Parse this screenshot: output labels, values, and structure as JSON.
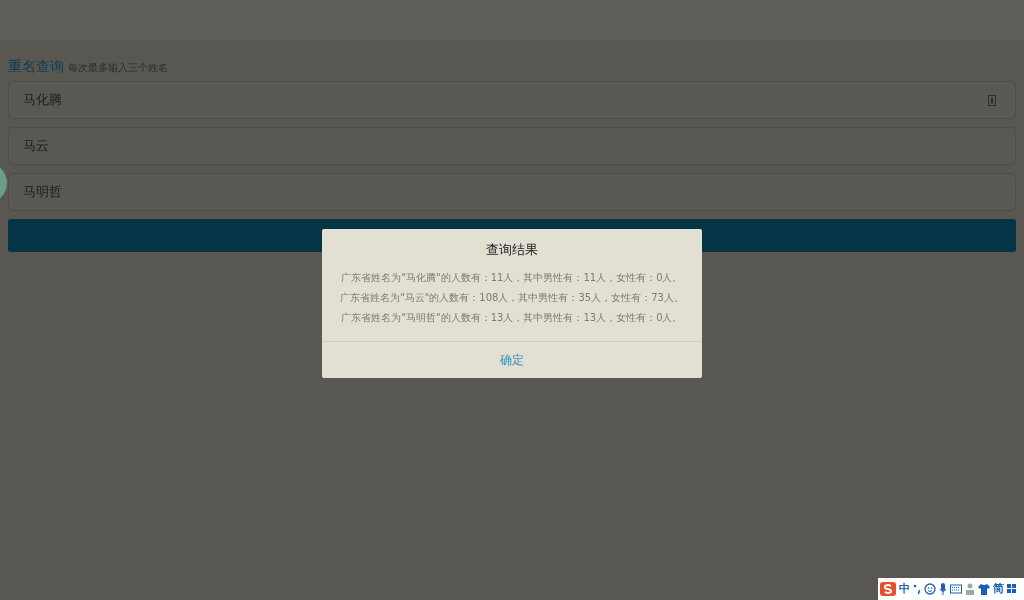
{
  "page": {
    "title": "重名查询",
    "hint": "每次最多输入三个姓名"
  },
  "fields": [
    {
      "value": "马化腾",
      "has_icon": true
    },
    {
      "value": "马云",
      "has_icon": false
    },
    {
      "value": "马明哲",
      "has_icon": false
    }
  ],
  "dialog": {
    "title": "查询结果",
    "lines": [
      "广东省姓名为\"马化腾\"的人数有：11人，其中男性有：11人，女性有：0人。",
      "广东省姓名为\"马云\"的人数有：108人，其中男性有：35人，女性有：73人。",
      "广东省姓名为\"马明哲\"的人数有：13人，其中男性有：13人，女性有：0人。"
    ],
    "button": "确定"
  },
  "ime_toolbar": {
    "mode": "中",
    "script": "简"
  }
}
